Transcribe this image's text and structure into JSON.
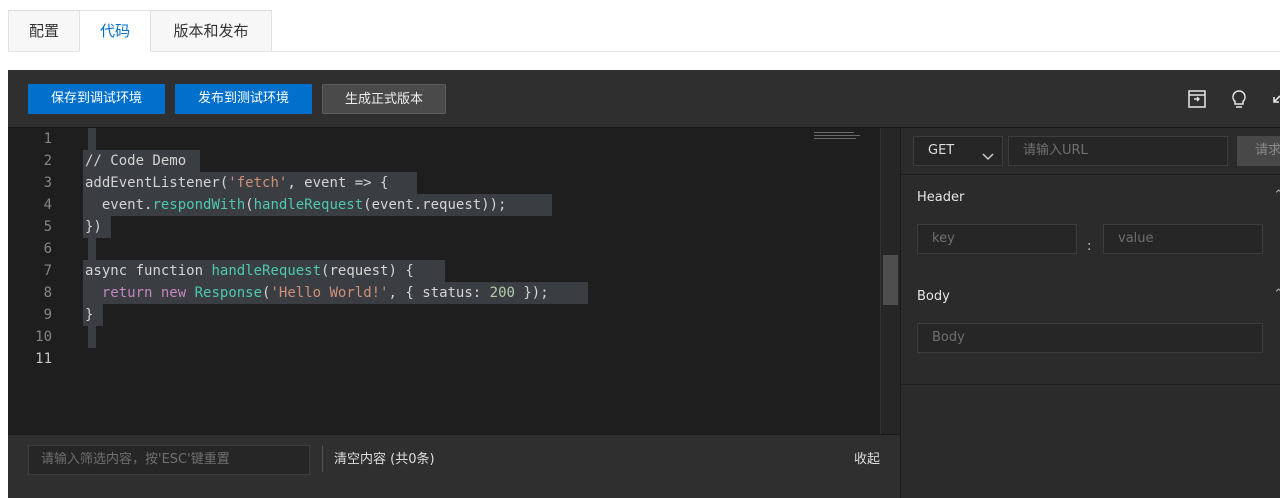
{
  "tabs": [
    {
      "label": "配置"
    },
    {
      "label": "代码"
    },
    {
      "label": "版本和发布"
    }
  ],
  "active_tab": "代码",
  "toolbar": {
    "save_debug": "保存到调试环境",
    "publish_test": "发布到测试环境",
    "build_release": "生成正式版本",
    "icons": [
      "panel-toggle-icon",
      "lightbulb-icon",
      "collapse-arrow-icon"
    ]
  },
  "editor": {
    "line_numbers": [
      "1",
      "2",
      "3",
      "4",
      "5",
      "6",
      "7",
      "8",
      "9",
      "10",
      "11"
    ],
    "active_line": "11",
    "lines": [
      "",
      "// Code Demo",
      "addEventListener('fetch', event => {",
      "  event.respondWith(handleRequest(event.request));",
      "})",
      "",
      "async function handleRequest(request) {",
      "  return new Response('Hello World!', { status: 200 });",
      "}",
      "",
      ""
    ]
  },
  "console": {
    "filter_placeholder": "请输入筛选内容，按'ESC'键重置",
    "clear_label": "清空内容 (共0条)",
    "collapse_label": "收起"
  },
  "request": {
    "method": "GET",
    "url_placeholder": "请输入URL",
    "send_label": "请求",
    "header_label": "Header",
    "key_placeholder": "key",
    "colon": ":",
    "value_placeholder": "value",
    "body_label": "Body",
    "body_placeholder": "Body"
  },
  "colors": {
    "primary": "#0070cc",
    "editor_bg": "#1e1e1e",
    "string": "#ce9178",
    "keyword": "#c586c0",
    "type": "#4ec9b0",
    "number": "#b5cea8"
  }
}
